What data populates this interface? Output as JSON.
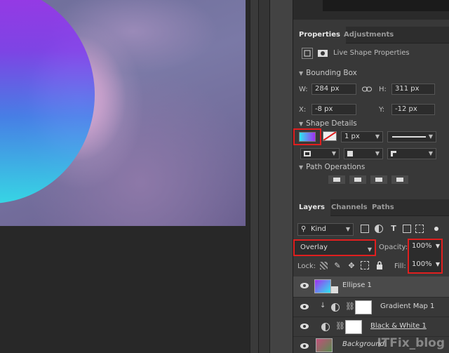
{
  "properties_panel": {
    "tabs": [
      {
        "label": "Properties",
        "active": true
      },
      {
        "label": "Adjustments",
        "active": false
      }
    ],
    "live_shape_label": "Live Shape Properties",
    "bounding_box": {
      "title": "Bounding Box",
      "w_label": "W:",
      "w_value": "284 px",
      "h_label": "H:",
      "h_value": "311 px",
      "x_label": "X:",
      "x_value": "-8 px",
      "y_label": "Y:",
      "y_value": "-12 px"
    },
    "shape_details": {
      "title": "Shape Details",
      "stroke_width": "1 px"
    },
    "path_operations": {
      "title": "Path Operations"
    }
  },
  "layers_panel": {
    "tabs": [
      {
        "label": "Layers",
        "active": true
      },
      {
        "label": "Channels",
        "active": false
      },
      {
        "label": "Paths",
        "active": false
      }
    ],
    "filter_kind": "Kind",
    "blend_mode": "Overlay",
    "opacity_label": "Opacity:",
    "opacity_value": "100%",
    "lock_label": "Lock:",
    "fill_label": "Fill:",
    "fill_value": "100%",
    "layers": [
      {
        "name": "Ellipse 1",
        "selected": true
      },
      {
        "name": "Gradient Map 1",
        "selected": false
      },
      {
        "name": "Black & White 1",
        "selected": false
      },
      {
        "name": "Background",
        "selected": false
      }
    ]
  },
  "watermark": "ITFix_blog",
  "colors": {
    "highlight": "#e01f1f",
    "gradient_start": "#a22ef2",
    "gradient_end": "#2ce8f0"
  }
}
